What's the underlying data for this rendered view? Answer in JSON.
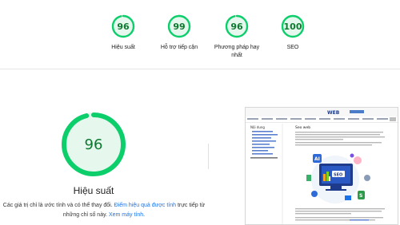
{
  "categories": [
    {
      "score": "96",
      "label": "Hiệu suất",
      "value": 0.96
    },
    {
      "score": "99",
      "label": "Hỗ trợ tiếp cận",
      "value": 0.99
    },
    {
      "score": "96",
      "label": "Phương pháp hay nhất",
      "value": 0.96
    },
    {
      "score": "100",
      "label": "SEO",
      "value": 1.0
    }
  ],
  "main": {
    "score": "96",
    "value": 0.96,
    "label": "Hiệu suất",
    "note_prefix": "Các giá trị chỉ là ước tính và có thể thay đổi. ",
    "note_link1": "Điểm hiệu quả được tính",
    "note_middle": " trực tiếp từ những chỉ số này. ",
    "note_link2": "Xem máy tính",
    "note_suffix": "."
  },
  "screenshot": {
    "logo": "WEB",
    "sidebar_title": "Nội dung",
    "article_title": "Seo web",
    "badges": [
      "AI",
      "SEO",
      "S"
    ]
  },
  "colors": {
    "pass_green": "#0cce6b",
    "pass_text": "#0c7a2e",
    "pass_fill": "#e6f7ee",
    "link": "#1a73e8"
  }
}
